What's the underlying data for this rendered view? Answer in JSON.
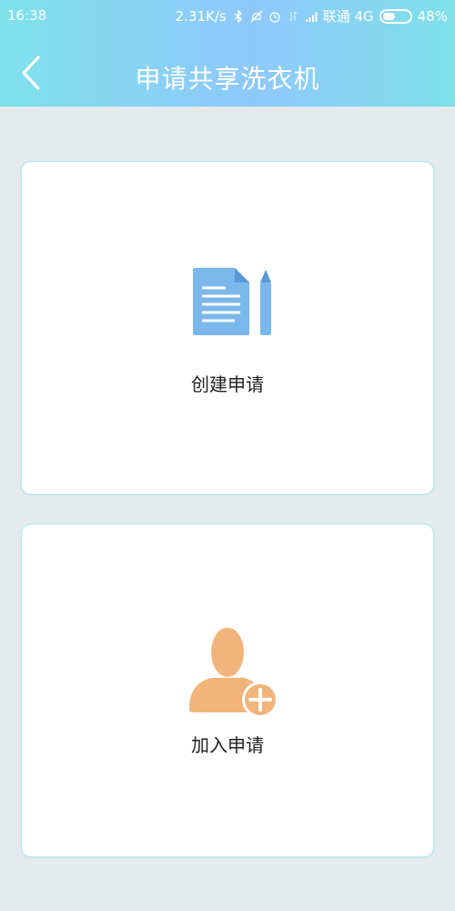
{
  "status_bar": {
    "time": "16:38",
    "network_speed": "2.31K/s",
    "carrier": "联通 4G",
    "battery": "48%",
    "battery_level": 0.48,
    "icons": [
      "bluetooth-icon",
      "mute-icon",
      "alarm-icon",
      "data-arrows-icon",
      "signal-icon"
    ]
  },
  "header": {
    "title": "申请共享洗衣机",
    "back_icon": "chevron-left-icon"
  },
  "actions": [
    {
      "label": "创建申请",
      "icon": "document-pencil-icon"
    },
    {
      "label": "加入申请",
      "icon": "person-add-icon"
    }
  ],
  "colors": {
    "header_gradient_start": "#7fe1ea",
    "header_gradient_mid": "#8ec8fb",
    "background": "#e5ebec",
    "card_border": "#b7ecef",
    "document_icon": "#7bb7ea",
    "person_icon": "#f1b57c"
  }
}
